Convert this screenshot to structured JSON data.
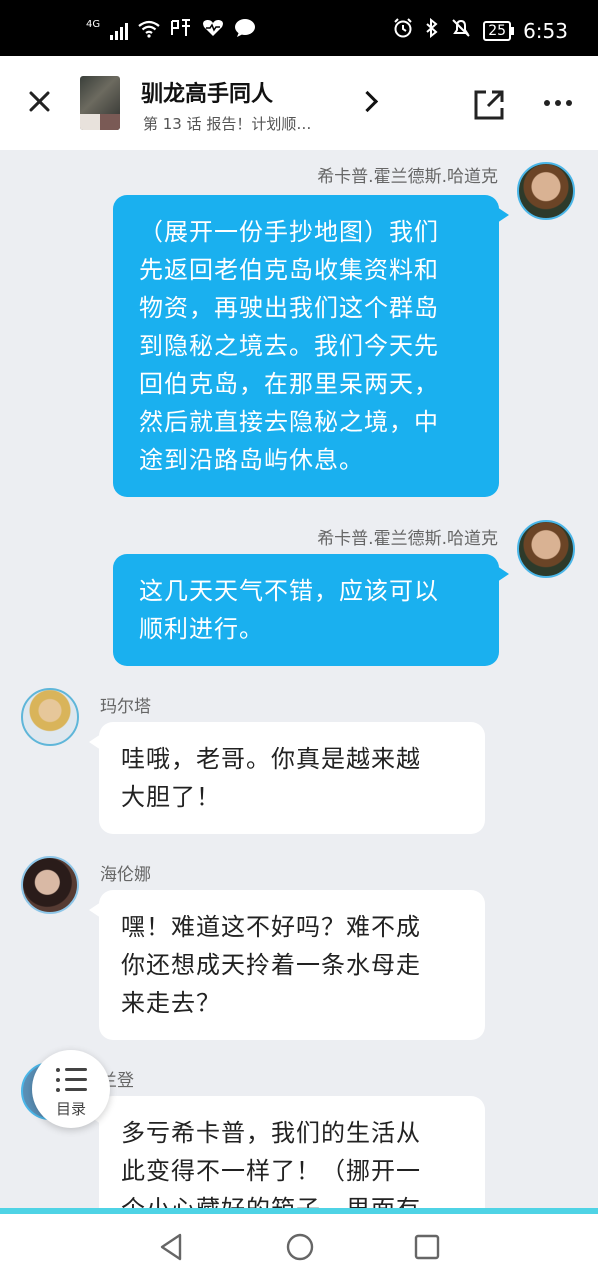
{
  "status_bar": {
    "network": "4G",
    "time": "6:53",
    "battery": "25"
  },
  "header": {
    "title": "驯龙高手同人",
    "subtitle": "第 13 话 报告！计划顺…"
  },
  "messages": [
    {
      "side": "right",
      "author": "希卡普.霍兰德斯.哈道克",
      "text_lines": [
        "（展开一份手抄地图）我们",
        "先返回老伯克岛收集资料和",
        "物资，再驶出我们这个群岛",
        "到隐秘之境去。我们今天先",
        "回伯克岛，在那里呆两天，",
        "然后就直接去隐秘之境，中",
        "途到沿路岛屿休息。"
      ]
    },
    {
      "side": "right",
      "author": "希卡普.霍兰德斯.哈道克",
      "text_lines": [
        "这几天天气不错，应该可以",
        "顺利进行。"
      ]
    },
    {
      "side": "left",
      "author": "玛尔塔",
      "text_lines": [
        "哇哦，老哥。你真是越来越",
        "大胆了！"
      ]
    },
    {
      "side": "left",
      "author": "海伦娜",
      "text_lines": [
        "嘿！难道这不好吗？难不成",
        "你还想成天拎着一条水母走",
        "来走去？"
      ]
    },
    {
      "side": "left",
      "author": "兰登",
      "text_lines": [
        "多亏希卡普，我们的生活从",
        "此变得不一样了！（挪开一",
        "个小心藏好的箱子，里面有"
      ]
    }
  ],
  "toc": {
    "label": "目录"
  }
}
